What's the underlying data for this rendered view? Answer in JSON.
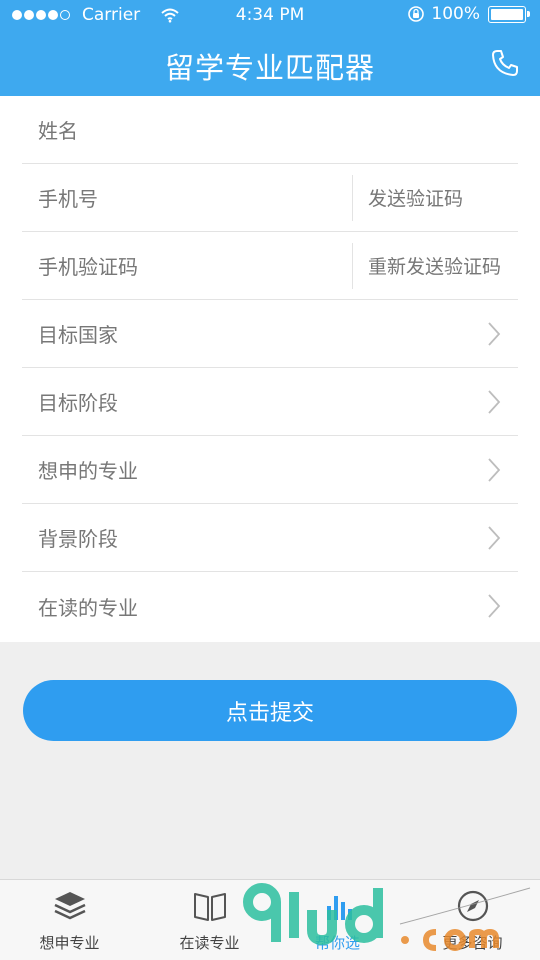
{
  "status_bar": {
    "carrier": "Carrier",
    "time": "4:34 PM",
    "battery": "100%"
  },
  "header": {
    "title": "留学专业匹配器",
    "icon": "phone-icon"
  },
  "form": {
    "name_label": "姓名",
    "phone_label": "手机号",
    "send_code": "发送验证码",
    "code_label": "手机验证码",
    "resend_code": "重新发送验证码",
    "target_country": "目标国家",
    "target_stage": "目标阶段",
    "desired_major": "想申的专业",
    "background_stage": "背景阶段",
    "current_major": "在读的专业"
  },
  "submit_label": "点击提交",
  "tabs": [
    {
      "label": "想申专业",
      "icon": "layers-icon"
    },
    {
      "label": "在读专业",
      "icon": "book-icon"
    },
    {
      "label": "帮你选",
      "icon": "chart-icon"
    },
    {
      "label": "更多咨询",
      "icon": "compass-icon"
    }
  ],
  "colors": {
    "header": "#3ea9ef",
    "accent": "#2f9df0",
    "background": "#efefef"
  }
}
